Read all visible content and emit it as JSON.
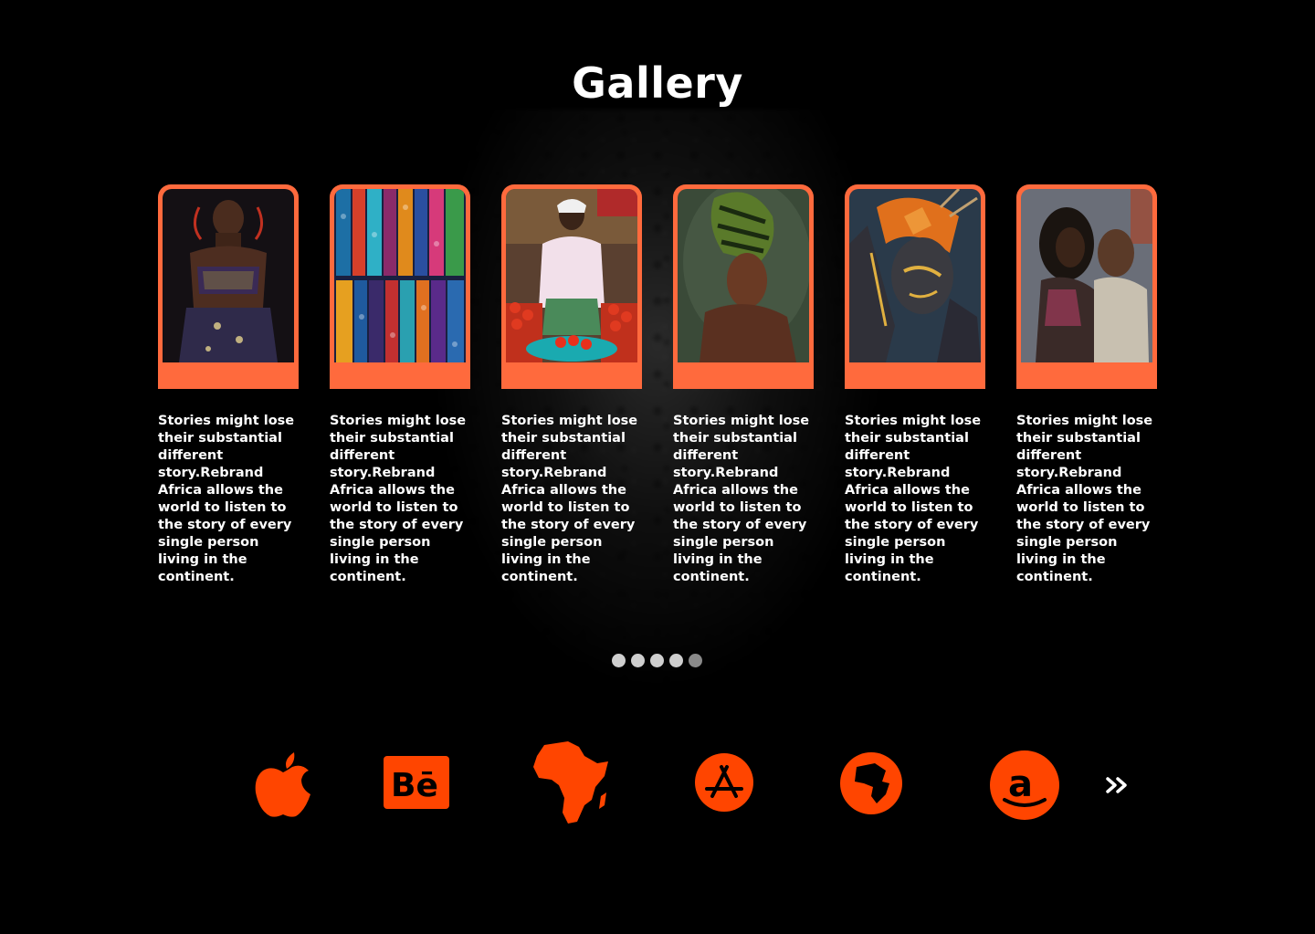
{
  "page": {
    "title": "Gallery",
    "accent_color": "#ff6a3d",
    "background_color": "#000000"
  },
  "cards": [
    {
      "image": "woman-with-beaded-jewelry-photo",
      "text": "Stories might lose their substantial different story.Rebrand Africa allows the world to listen to the story of every single person living in the continent."
    },
    {
      "image": "colorful-african-fabrics-photo",
      "text": "Stories might lose their substantial different story.Rebrand Africa allows the world to listen to the story of every single person living in the continent."
    },
    {
      "image": "market-vendor-tomatoes-photo",
      "text": "Stories might lose their substantial different story.Rebrand Africa allows the world to listen to the story of every single person living in the continent."
    },
    {
      "image": "woman-in-headwrap-photo",
      "text": "Stories might lose their substantial different story.Rebrand Africa allows the world to listen to the story of every single person living in the continent."
    },
    {
      "image": "gold-body-paint-portrait-photo",
      "text": "Stories might lose their substantial different story.Rebrand Africa allows the world to listen to the story of every single person living in the continent."
    },
    {
      "image": "couple-embracing-photo",
      "text": "Stories might lose their substantial different story.Rebrand Africa allows the world to listen to the story of every single person living in the continent."
    }
  ],
  "carousel": {
    "dot_count": 5,
    "active_index": 4
  },
  "footer_icons": [
    "apple-icon",
    "behance-icon",
    "africa-map-icon",
    "app-store-icon",
    "globe-africa-icon",
    "amazon-icon"
  ],
  "next_icon": "double-chevron-right-icon"
}
